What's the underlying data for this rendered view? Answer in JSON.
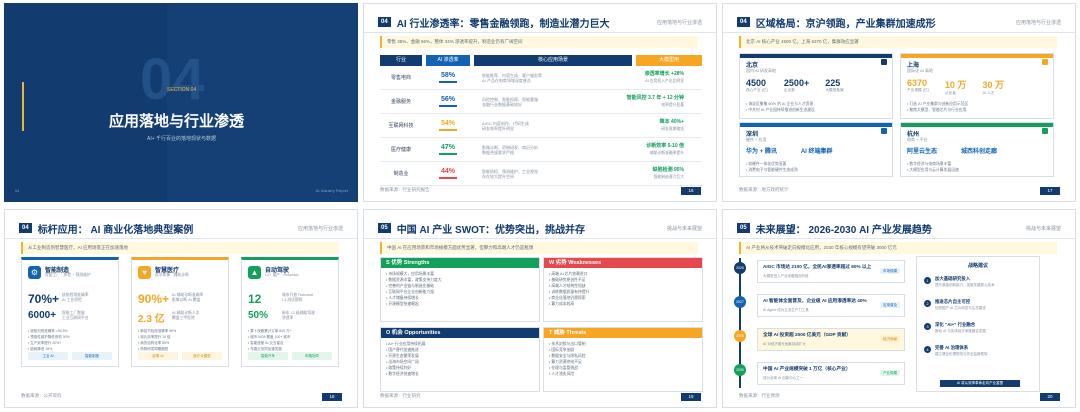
{
  "slides": {
    "cover": {
      "section_label": "SECTION 04",
      "big_number": "04",
      "title": "应用落地与行业渗透",
      "subtitle": "AI+ 千行百业的落地现状与数据",
      "footer_left": "04",
      "footer_right": "AI Industry Report"
    },
    "penetration": {
      "num": "04",
      "title": "AI 行业渗透率：零售金融领跑，制造业潜力巨大",
      "top_right": "应用落地与行业渗透",
      "intro": "零售 38%、金融 56%，整体 34% 渗透率提升，制造业仍有广阔空间",
      "headers": [
        "行业",
        "AI 渗透率",
        "核心应用场景",
        "大模型用"
      ],
      "rows": [
        {
          "industry": "零售电商",
          "rate": "58%",
          "desc": "智能推荐、内容生成、客户服务等\nAI 产品在电商领域深度普及",
          "adv": "渗透率增长 +28%",
          "adv_sub": "AI 应用投入产出比明显"
        },
        {
          "industry": "金融服务",
          "rate": "56%",
          "desc": "风险控制、智能投顾、智能客服\n金融行业数据基础较好",
          "adv": "智能风控 3.7 年 + 12 分钟",
          "adv_sub": "效率提升显著"
        },
        {
          "industry": "互联网科技",
          "rate": "54%",
          "desc": "AIGC 内容创作、代码生成\n研发效率提升明显",
          "adv": "降本 40%+",
          "adv_sub": "研发周期缩短"
        },
        {
          "industry": "医疗健康",
          "rate": "47%",
          "desc": "影像诊断、药物研发、病历分析\n数据合规要求严格",
          "adv": "诊断效率 5-10 倍",
          "adv_sub": "辅助诊断准确率提升"
        },
        {
          "industry": "制造业",
          "rate": "44%",
          "desc": "智能质检、预测维护、工业视觉\n存在较大提升空间",
          "adv": "缺陷检测 95%",
          "adv_sub": "智能制造潜力巨大"
        }
      ],
      "source": "数据来源：行业研究报告",
      "page": "16"
    },
    "regions": {
      "num": "04",
      "title": "区域格局：京沪领跑，产业集群加速成形",
      "top_right": "应用落地与行业渗透",
      "intro": "北京 AI 核心产业 4500 亿，上海 6370 亿，集群效应显著",
      "beijing": {
        "name": "北京",
        "note": "国内 AI 研发高地",
        "m1": "4500",
        "l1": "核心产业 (亿)",
        "m2": "2500+",
        "l2": "企业数",
        "m3": "225",
        "l3": "大模型备案",
        "b1": "• 海淀区聚集 60% 的 AI 企业与人才资源",
        "b2": "• 中关村 AI 产业园持续推进创新生态建设"
      },
      "shanghai": {
        "name": "上海",
        "note": "国际化 AI 高地",
        "m1": "6370",
        "l1": "产业规模 (亿)",
        "m2": "10 万",
        "l2": "从业者",
        "m3": "30 万",
        "l3": "AI 人才",
        "b1": "• 打造 AI 产业集群与创新应用示范区",
        "b2": "• 聚焦大模型、智能芯片与行业应用"
      },
      "shenzhen": {
        "name": "深圳",
        "note": "硬件 + 应用",
        "m1": "华为 + 腾讯",
        "m2": "AI 终端集群",
        "b1": "• 软硬件一体化优势显著",
        "b2": "• 消费电子与智能硬件生态成熟"
      },
      "hangzhou": {
        "name": "杭州",
        "note": "电商 + 平台",
        "m1": "阿里云生态",
        "m2": "城西科创走廊",
        "b1": "• 数字经济与电商场景丰富",
        "b2": "• 大模型应用与云计算发展迅速"
      },
      "source": "数据来源：地方政府统计",
      "page": "17"
    },
    "cases": {
      "num": "04",
      "title": "标杆应用： AI 商业化落地典型案例",
      "top_right": "应用落地与行业渗透",
      "intro": "从工业制造到智慧医疗，AI 应用场景正在加速落地",
      "items": [
        {
          "title": "智能制造",
          "sub": "智能工厂 · 质检 + 预测维护",
          "n1": "70%+",
          "l1": "缺陷检测准确率\nAI 工业质检",
          "n2": "6000+",
          "l2": "智能工厂数量\n工业互联网平台",
          "b": "• 缺陷识别准确率 >99.5%\n• 预测性维护降低停机 30%\n• 生产效率提升 20%+\n• 能耗降低 15%",
          "tag1": "工业 AI",
          "tag2": "智能制造",
          "color": "#1264b3",
          "icon": "⚙"
        },
        {
          "title": "智慧医疗",
          "sub": "医学影像 · 辅助诊断",
          "n1": "90%+",
          "l1": "AI 辅助诊断准确率\n影像诊断 AI 覆盖",
          "n2": "2.3 亿",
          "l2": "AI 辅助诊断人次\n覆盖三甲医院",
          "b": "• 肺结节检测准确率 96%\n• 阅片效率提升 10 倍\n• 病历结构化率 85%\n• 药物研发周期缩短",
          "tag1": "影像 AI",
          "tag2": "医疗大模型",
          "color": "#f6a623",
          "icon": "♥"
        },
        {
          "title": "自动驾驶",
          "sub": "L2+ 量产 · Robotaxi",
          "n1": "12",
          "l1": "城市开放 Robotaxi\nL4 测试牌照",
          "n2": "50%",
          "l2": "新车 L2 级辅助驾驶\n渗透率",
          "b": "• 萝卜快跑累计订单 600 万+\n• 城市 NOA 覆盖 100+ 城市\n• 智能座舱 AI 交互普及\n• 车路云协同加速发展",
          "tag1": "智能汽车",
          "tag2": "车路协同",
          "color": "#12a05a",
          "icon": "▲"
        }
      ],
      "source": "数据来源：公开资料",
      "page": "18"
    },
    "swot": {
      "num": "05",
      "title": "中国 AI 产业 SWOT：优势突出，挑战并存",
      "top_right": "挑战与未来展望",
      "intro": "中国 AI 在应用场景和市场规模方面优势显著，但算力和高端人才仍是瓶颈",
      "s": {
        "title": "S 优势 Strengths",
        "items": [
          "• 市场规模大，应用场景丰富",
          "• 数据资源丰富，政策支持力度大",
          "• 完善的产业链与制造业基础",
          "• 互联网平台企业创新能力强",
          "• 人才储备持续增长",
          "• 开源模型快速崛起"
        ]
      },
      "w": {
        "title": "W 劣势 Weaknesses",
        "items": [
          "• 高端 AI 芯片依赖进口",
          "• 基础研究原创性不足",
          "• 高端人才结构性短缺",
          "• 训练数据质量有待提升",
          "• 商业化落地仍需探索",
          "• 算力成本较高"
        ]
      },
      "o": {
        "title": "O 机会 Opportunities",
        "items": [
          "• AI+ 行业应用持续拓展",
          "• 国产替代加速推进",
          "• 开源生态繁荣发展",
          "• 出海市场空间广阔",
          "• 政策持续利好",
          "• 数字经济快速增长"
        ]
      },
      "t": {
        "title": "T 威胁 Threats",
        "items": [
          "• 技术封锁与出口管制",
          "• 国际竞争加剧",
          "• 数据安全与隐私风险",
          "• 算力资源供给不足",
          "• 伦理与监管挑战",
          "• 人才流失风险"
        ]
      },
      "source": "数据来源：行业研究",
      "page": "19"
    },
    "future": {
      "num": "05",
      "title": "未来展望： 2026-2030 AI 产业发展趋势",
      "top_right": "挑战与未来展望",
      "intro": "AI 产业将从技术突破走向规模化应用，2030 年核心规模有望突破 3000 亿元",
      "timeline": [
        {
          "year": "2026",
          "title": "AIGC 市场达 2100 亿，全民AI渗透率超过 60% 以上",
          "sub": "大模型进入产业深度融合阶段",
          "badge": "市场规模"
        },
        {
          "year": "2027",
          "title": "AI 智能体全面普及，企业级 AI 应用渗透率达 40%",
          "sub": "AI Agent 成为主流生产力工具",
          "badge": "应用普及"
        },
        {
          "year": "2028",
          "title": "全球 AI 投资超 2000 亿美元（GDP 贡献）",
          "sub": "AI 对经济增长贡献持续扩大",
          "badge": "经济贡献"
        },
        {
          "year": "2030",
          "title": "中国 AI 产业规模突破 1 万亿（核心产业）",
          "sub": "成为全球 AI 创新中心之一",
          "badge": "产业规模"
        }
      ],
      "strategy": {
        "title": "战略建议",
        "items": [
          {
            "t": "加大基础研究投入",
            "s": "提升原始创新能力，突破关键核心技术"
          },
          {
            "t": "推进芯片自主可控",
            "s": "加快国产 AI 芯片研发与生态建设"
          },
          {
            "t": "深化 “AI+” 行业融合",
            "s": "推动 AI 与实体经济深度融合发展"
          },
          {
            "t": "完善 AI 治理体系",
            "s": "建立健全伦理规范与安全监管框架"
          }
        ],
        "footer": "AI 将从效率革命走向产业重塑"
      },
      "source": "数据来源：行业预测",
      "page": "20"
    }
  }
}
